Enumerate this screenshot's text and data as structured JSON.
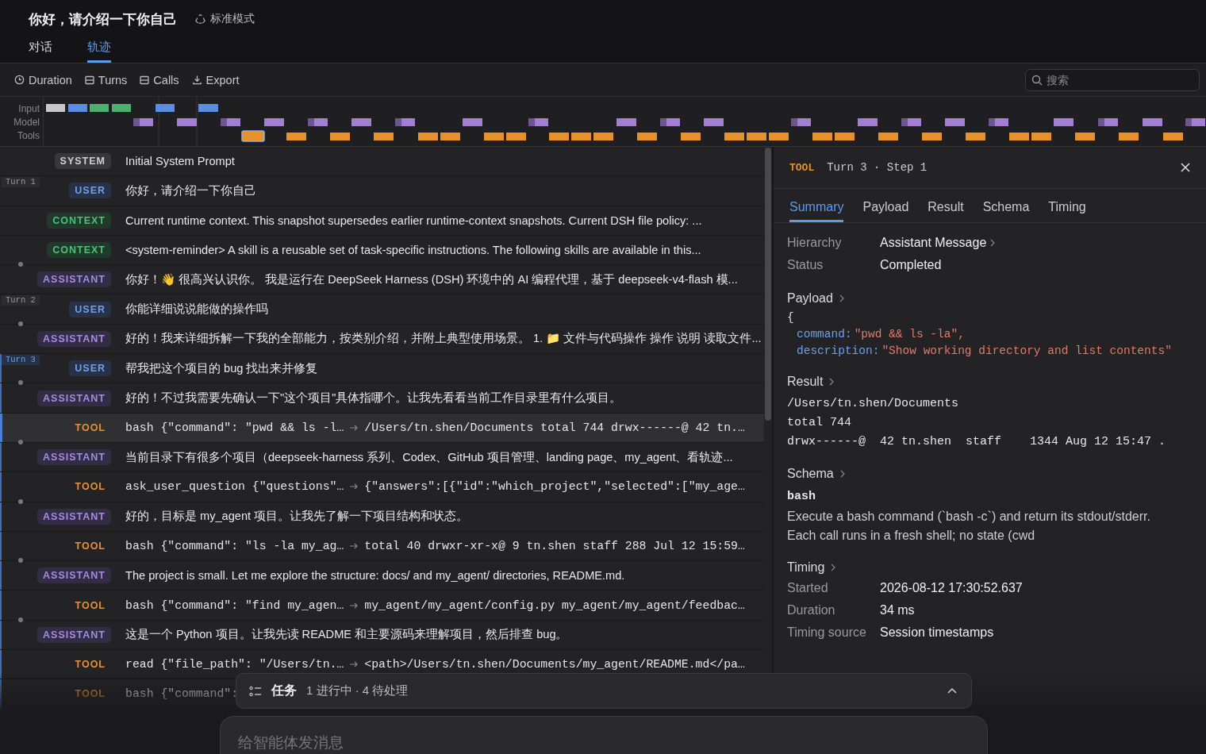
{
  "header": {
    "title": "你好，请介绍一下你自己",
    "mode": "标准模式"
  },
  "tabs": [
    {
      "label": "对话",
      "selected": false
    },
    {
      "label": "轨迹",
      "selected": true
    }
  ],
  "toolbar": {
    "buttons": [
      {
        "kind": "clock",
        "label": "Duration"
      },
      {
        "kind": "list",
        "label": "Turns"
      },
      {
        "kind": "list",
        "label": "Calls"
      },
      {
        "kind": "download",
        "label": "Export"
      }
    ],
    "search": {
      "placeholder": "搜索"
    }
  },
  "timeline": {
    "lanes": [
      "Input",
      "Model",
      "Tools"
    ]
  },
  "rows": [
    {
      "kind": "system",
      "role": "SYSTEM",
      "text": "Initial System Prompt",
      "selected": false
    },
    {
      "kind": "user",
      "role": "USER",
      "text": "你好，请介绍一下你自己",
      "selected": false,
      "turn": {
        "label": "Turn 1",
        "selected": false
      }
    },
    {
      "kind": "context",
      "role": "CONTEXT",
      "text": "Current runtime context. This snapshot supersedes earlier runtime-context snapshots. Current DSH file policy: ...",
      "selected": false
    },
    {
      "kind": "context",
      "role": "CONTEXT",
      "text": "<system-reminder> A skill is a reusable set of task-specific instructions. The following skills are available in this...",
      "selected": false
    },
    {
      "kind": "assistant",
      "role": "ASSISTANT",
      "text": "你好！👋 很高兴认识你。 我是运行在 DeepSeek Harness (DSH) 环境中的 AI 编程代理，基于 deepseek-v4-flash 模...",
      "selected": false
    },
    {
      "kind": "user",
      "role": "USER",
      "text": "你能详细说说能做的操作吗",
      "selected": false,
      "turn": {
        "label": "Turn 2",
        "selected": false
      }
    },
    {
      "kind": "assistant",
      "role": "ASSISTANT",
      "text": "好的！我来详细拆解一下我的全部能力，按类别介绍，并附上典型使用场景。 1. 📁 文件与代码操作 操作 说明 读取文件...",
      "selected": false
    },
    {
      "kind": "user",
      "role": "USER",
      "text": "帮我把这个项目的 bug 找出来并修复",
      "selected": false,
      "turn": {
        "label": "Turn 3",
        "selected": true
      }
    },
    {
      "kind": "assistant",
      "role": "ASSISTANT",
      "text": "好的！不过我需要先确认一下\"这个项目\"具体指哪个。让我先看看当前工作目录里有什么项目。",
      "selected": false
    },
    {
      "kind": "tool",
      "role": "TOOL",
      "call": "bash {\"command\": \"pwd && ls -l…",
      "result": "/Users/tn.shen/Documents total 744 drwx------@ 42 tn.…",
      "selected": true
    },
    {
      "kind": "assistant",
      "role": "ASSISTANT",
      "text": "当前目录下有很多个项目（deepseek-harness 系列、Codex、GitHub 项目管理、landing page、my_agent、看轨迹...",
      "selected": false
    },
    {
      "kind": "tool",
      "role": "TOOL",
      "call": "ask_user_question {\"questions\"…",
      "result": "{\"answers\":[{\"id\":\"which_project\",\"selected\":[\"my_age…",
      "selected": false
    },
    {
      "kind": "assistant",
      "role": "ASSISTANT",
      "text": "好的，目标是 my_agent 项目。让我先了解一下项目结构和状态。",
      "selected": false
    },
    {
      "kind": "tool",
      "role": "TOOL",
      "call": "bash {\"command\": \"ls -la my_ag…",
      "result": "total 40 drwxr-xr-x@ 9 tn.shen staff 288 Jul 12 15:59…",
      "selected": false
    },
    {
      "kind": "assistant",
      "role": "ASSISTANT",
      "text": "The project is small. Let me explore the structure: docs/ and my_agent/ directories, README.md.",
      "selected": false
    },
    {
      "kind": "tool",
      "role": "TOOL",
      "call": "bash {\"command\": \"find my_agen…",
      "result": "my_agent/my_agent/config.py my_agent/my_agent/feedbac…",
      "selected": false
    },
    {
      "kind": "assistant",
      "role": "ASSISTANT",
      "text": "这是一个 Python 项目。让我先读 README 和主要源码来理解项目，然后排查 bug。",
      "selected": false
    },
    {
      "kind": "tool",
      "role": "TOOL",
      "call": "read {\"file_path\": \"/Users/tn.…",
      "result": "<path>/Users/tn.shen/Documents/my_agent/README.md</pa…",
      "selected": false
    },
    {
      "kind": "tool",
      "role": "TOOL",
      "call": "bash {\"command\":",
      "selected": false
    }
  ],
  "detail": {
    "badge": "TOOL",
    "title": "Turn 3 · Step 1",
    "tabs": [
      {
        "label": "Summary",
        "selected": true
      },
      {
        "label": "Payload",
        "selected": false
      },
      {
        "label": "Result",
        "selected": false
      },
      {
        "label": "Schema",
        "selected": false
      },
      {
        "label": "Timing",
        "selected": false
      }
    ],
    "summary": [
      {
        "label": "Hierarchy",
        "value": "Assistant Message",
        "link": true
      },
      {
        "label": "Status",
        "value": "Completed",
        "link": false
      }
    ],
    "payload": {
      "heading": "Payload",
      "open": "{",
      "fields": [
        {
          "key": "command:",
          "value": "\"pwd && ls -la\","
        },
        {
          "key": "description:",
          "value": "\"Show working directory and list contents\""
        }
      ]
    },
    "result": {
      "heading": "Result",
      "lines": [
        "/Users/tn.shen/Documents",
        "total 744",
        "drwx------@  42 tn.shen  staff    1344 Aug 12 15:47 ."
      ]
    },
    "schema": {
      "heading": "Schema",
      "name": "bash",
      "description": "Execute a bash command (`bash -c`) and return its stdout/stderr. Each call runs in a fresh shell; no state (cwd"
    },
    "timing": {
      "heading": "Timing",
      "rows": [
        {
          "label": "Started",
          "value": "2026-08-12 17:30:52.637"
        },
        {
          "label": "Duration",
          "value": "34 ms"
        },
        {
          "label": "Timing source",
          "value": "Session timestamps"
        }
      ]
    }
  },
  "tasks": {
    "title": "任务",
    "status": "1 进行中 · 4 待处理"
  },
  "composer": {
    "placeholder": "给智能体发消息"
  }
}
